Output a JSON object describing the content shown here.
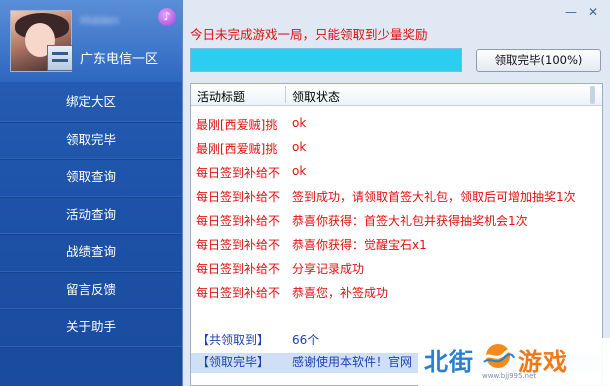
{
  "sidebar": {
    "username": "Hidden",
    "server": "广东电信一区",
    "menu": [
      "绑定大区",
      "领取完毕",
      "领取查询",
      "活动查询",
      "战绩查询",
      "留言反馈",
      "关于助手"
    ]
  },
  "window": {
    "minimize": "—",
    "close": "✕"
  },
  "notice": "今日未完成游戏一局，只能领取到少量奖励",
  "progress": {
    "value": 1.0
  },
  "finish_button": "领取完毕(100%)",
  "table": {
    "headers": [
      "活动标题",
      "领取状态"
    ],
    "rows": [
      {
        "title": "最刚[西爱贼]挑",
        "status": "ok"
      },
      {
        "title": "最刚[西爱贼]挑",
        "status": "ok"
      },
      {
        "title": "每日签到补给不",
        "status": "ok"
      },
      {
        "title": "每日签到补给不",
        "status": "签到成功，请领取首签大礼包，领取后可增加抽奖1次"
      },
      {
        "title": "每日签到补给不",
        "status": "恭喜你获得：首签大礼包并获得抽奖机会1次"
      },
      {
        "title": "每日签到补给不",
        "status": "恭喜你获得：觉醒宝石x1"
      },
      {
        "title": "每日签到补给不",
        "status": "分享记录成功"
      },
      {
        "title": "每日签到补给不",
        "status": "恭喜您，补签成功"
      }
    ],
    "summary": [
      {
        "title": "【共领取到】",
        "status": "66个"
      },
      {
        "title": "【领取完毕】",
        "status": "感谢使用本软件！官网"
      }
    ]
  },
  "watermark": {
    "left": "北街",
    "right": "游戏",
    "url": "www.bjj995.net"
  },
  "colors": {
    "sidebar": "#1d53a9",
    "status_red": "#e01010",
    "summary_blue": "#1e41b8",
    "progress": "#2bcdf0"
  }
}
